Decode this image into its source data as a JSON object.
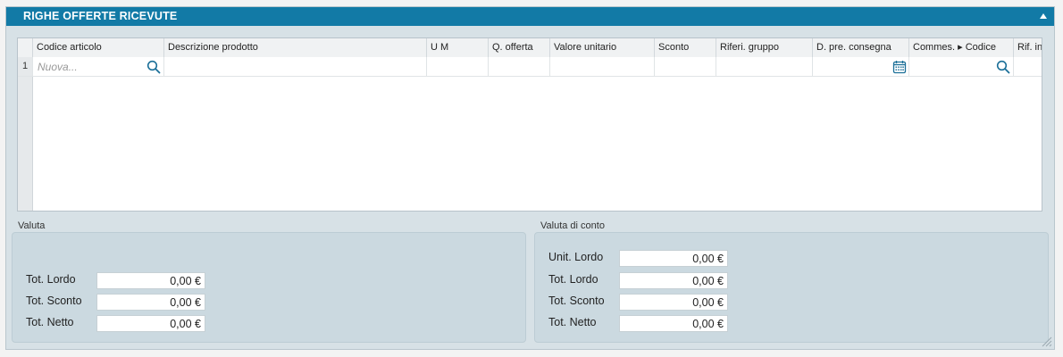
{
  "panel": {
    "title": "RIGHE OFFERTE RICEVUTE"
  },
  "grid": {
    "columns": [
      "Codice articolo",
      "Descrizione prodotto",
      "U M",
      "Q. offerta",
      "Valore unitario",
      "Sconto",
      "Riferi. gruppo",
      "D. pre. consegna",
      "Commes. ▸ Codice",
      "Rif. in"
    ],
    "rows": [
      {
        "num": "1",
        "codice_placeholder": "Nuova..."
      }
    ]
  },
  "valuta": {
    "label": "Valuta",
    "fields": [
      {
        "label": "Tot. Lordo",
        "value": "0,00 €"
      },
      {
        "label": "Tot. Sconto",
        "value": "0,00 €"
      },
      {
        "label": "Tot. Netto",
        "value": "0,00 €"
      }
    ]
  },
  "valuta_conto": {
    "label": "Valuta di conto",
    "fields": [
      {
        "label": "Unit. Lordo",
        "value": "0,00 €"
      },
      {
        "label": "Tot. Lordo",
        "value": "0,00 €"
      },
      {
        "label": "Tot. Sconto",
        "value": "0,00 €"
      },
      {
        "label": "Tot. Netto",
        "value": "0,00 €"
      }
    ]
  },
  "colors": {
    "titlebar": "#127aa6",
    "panel_bg": "#d7e1e6",
    "icon_accent": "#1b6f98"
  },
  "icons": {
    "search": "search-icon",
    "calendar": "calendar-icon",
    "collapse": "collapse-arrow-icon",
    "resize": "resize-grip-icon"
  }
}
